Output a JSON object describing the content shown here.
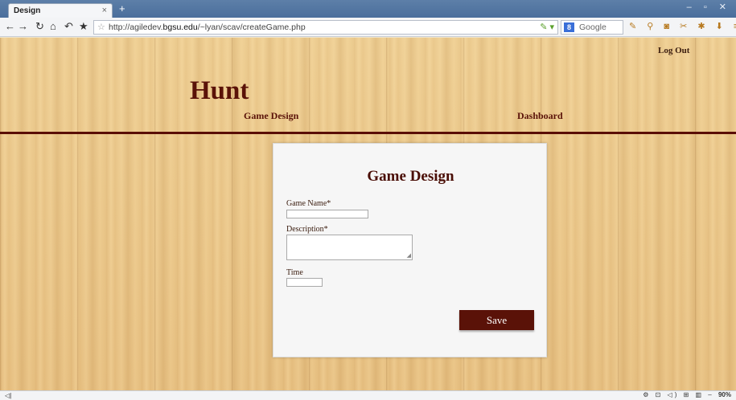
{
  "browser": {
    "tab_title": "Design",
    "tab_close": "×",
    "new_tab": "+",
    "url_prefix": "http://agiledev.",
    "url_host": "bgsu.edu",
    "url_suffix": "/~lyan/scav/createGame.php",
    "search_engine_icon": "8",
    "search_placeholder": "Google",
    "window_controls": "– ▫ ✕"
  },
  "header": {
    "logout_label": "Log Out",
    "site_title": "Hunt",
    "nav_game_design": "Game Design",
    "nav_dashboard": "Dashboard"
  },
  "form": {
    "title": "Game Design",
    "game_name_label": "Game Name*",
    "game_name_value": "",
    "description_label": "Description*",
    "description_value": "",
    "time_label": "Time",
    "time_value": "",
    "save_label": "Save"
  },
  "statusbar": {
    "zoom": "90%"
  },
  "colors": {
    "brand": "#5a1208",
    "divider": "#5a0e06",
    "wood": "#ecc98c"
  }
}
